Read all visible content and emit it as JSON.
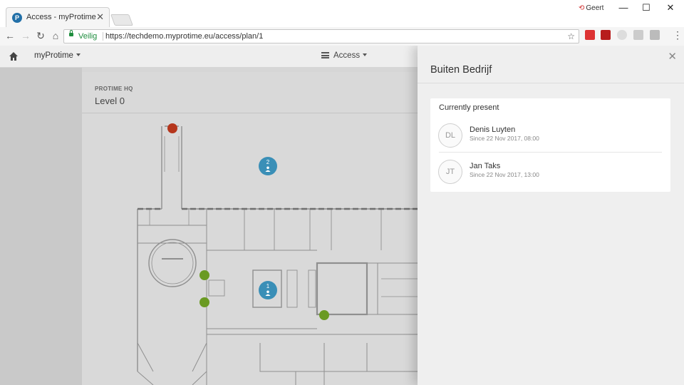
{
  "browser": {
    "tab_title": "Access - myProtime",
    "tab_close": "✕",
    "profile_name": "Geert",
    "secure_label": "Veilig",
    "url": "https://techdemo.myprotime.eu/access/plan/1",
    "window_controls": {
      "minimize": "—",
      "maximize": "☐",
      "close": "✕"
    },
    "menu": "⋮"
  },
  "appbar": {
    "brand": "myProtime",
    "access_menu": "Access"
  },
  "floor": {
    "building": "PROTIME HQ",
    "level": "Level 0",
    "clusters": [
      {
        "count": "2"
      },
      {
        "count": "1"
      }
    ]
  },
  "panel": {
    "title": "Buiten Bedrijf",
    "close": "✕",
    "section_heading": "Currently present",
    "people": [
      {
        "initials": "DL",
        "name": "Denis Luyten",
        "since": "Since 22 Nov 2017, 08:00"
      },
      {
        "initials": "JT",
        "name": "Jan Taks",
        "since": "Since 22 Nov 2017, 13:00"
      }
    ]
  },
  "colors": {
    "sensor_red": "#b5361c",
    "sensor_green": "#6a9a22",
    "cluster_blue": "#3a8fb7",
    "secure_green": "#1e8e3e"
  }
}
